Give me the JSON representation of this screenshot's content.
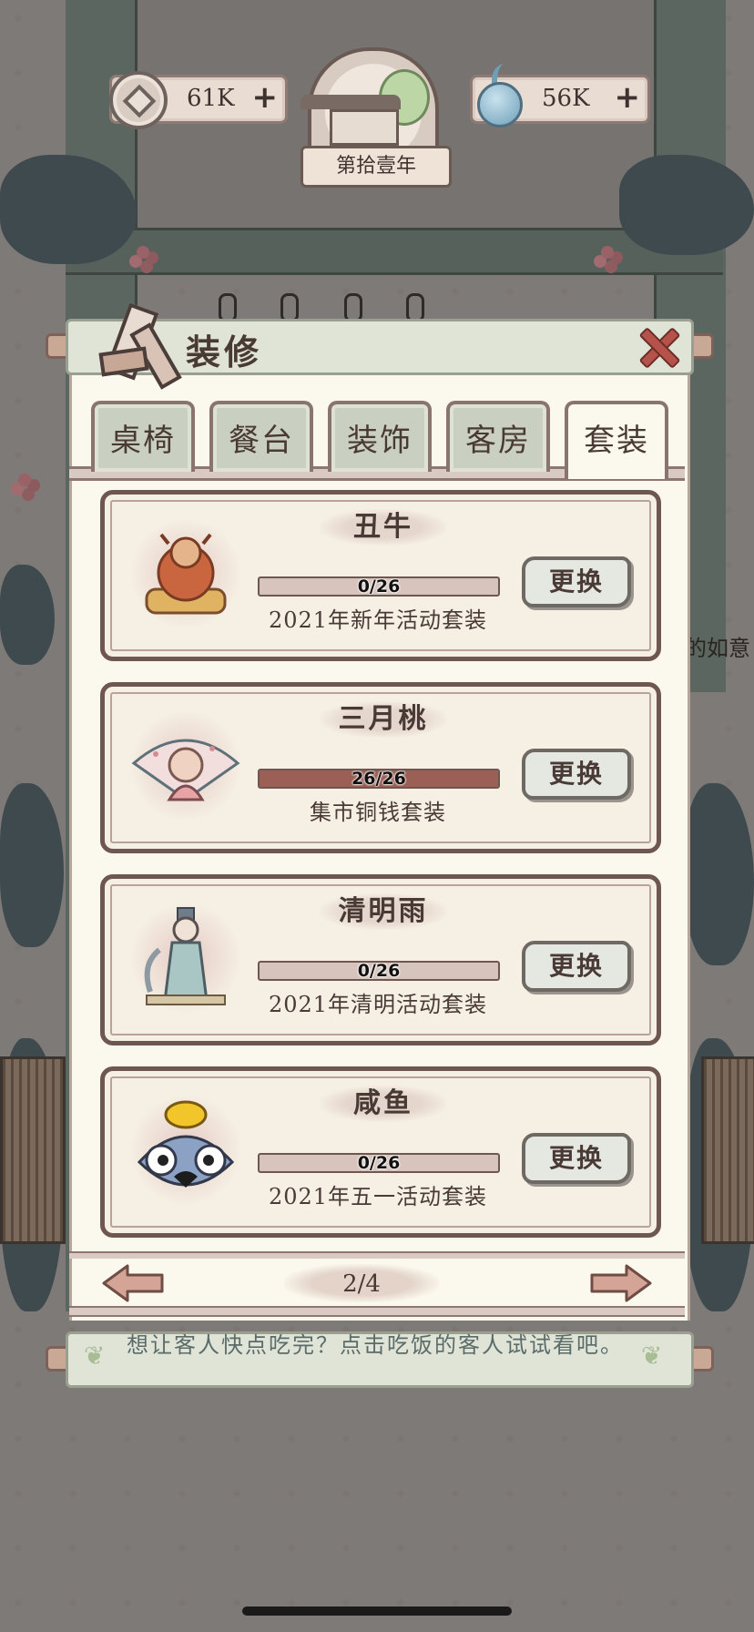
{
  "hud": {
    "coins": "61K",
    "coin_icon": "copper-coin-icon",
    "water": "56K",
    "water_icon": "water-drop-icon",
    "plus": "+",
    "year_label": "第拾壹年"
  },
  "panel": {
    "title": "装修",
    "close_icon": "close-icon"
  },
  "tabs": [
    {
      "label": "桌椅",
      "active": false
    },
    {
      "label": "餐台",
      "active": false
    },
    {
      "label": "装饰",
      "active": false
    },
    {
      "label": "客房",
      "active": false
    },
    {
      "label": "套装",
      "active": true
    }
  ],
  "sets": [
    {
      "name": "丑牛",
      "progress": "0/26",
      "collected": 0,
      "total": 26,
      "subtitle": "2021年新年活动套装",
      "button": "更换",
      "art": "ox-figure-icon"
    },
    {
      "name": "三月桃",
      "progress": "26/26",
      "collected": 26,
      "total": 26,
      "subtitle": "集市铜钱套装",
      "button": "更换",
      "art": "peach-blossom-fan-icon"
    },
    {
      "name": "清明雨",
      "progress": "0/26",
      "collected": 0,
      "total": 26,
      "subtitle": "2021年清明活动套装",
      "button": "更换",
      "art": "scholar-figure-icon"
    },
    {
      "name": "咸鱼",
      "progress": "0/26",
      "collected": 0,
      "total": 26,
      "subtitle": "2021年五一活动套装",
      "button": "更换",
      "art": "salted-fish-gold-icon"
    }
  ],
  "pager": {
    "current": "2/4",
    "prev_icon": "arrow-left-icon",
    "next_icon": "arrow-right-icon"
  },
  "tip": {
    "text": "想让客人快点吃完？点击吃饭的客人试试看吧。"
  },
  "background": {
    "side_text": "的如意"
  },
  "colors": {
    "panel_bg": "#fbf8ee",
    "card_border": "#6f5751",
    "progress_fill": "#9b5f55",
    "close_red": "#b5524a"
  }
}
